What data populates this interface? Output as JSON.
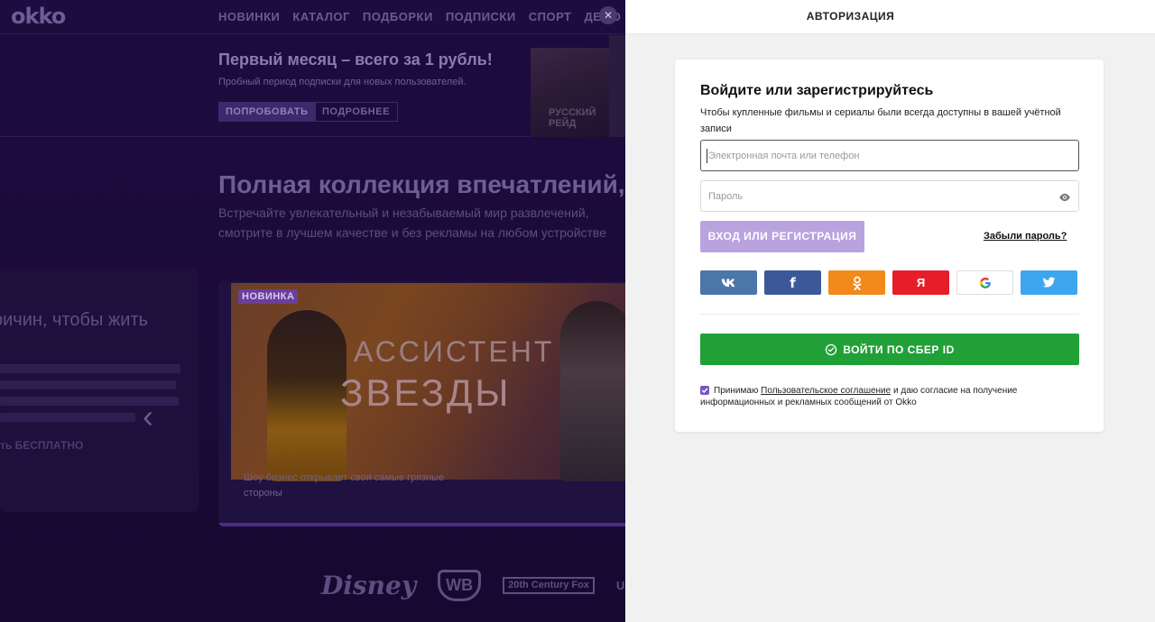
{
  "background": {
    "logo": "okko",
    "nav": [
      "НОВИНКИ",
      "КАТАЛОГ",
      "ПОДБОРКИ",
      "ПОДПИСКИ",
      "СПОРТ",
      "ДЕМО"
    ],
    "promo": {
      "title": "Первый месяц – всего за 1 рубль!",
      "subtitle": "Пробный период подписки для новых пользователей.",
      "try_label": "ПОПРОБОВАТЬ",
      "more_label": "ПОДРОБНЕЕ",
      "poster_text": "РУССКИЙ РЕЙД"
    },
    "hero": {
      "title": "Полная коллекция впечатлений, з",
      "subtitle": "Встречайте увлекательный и незабываемый мир развлечений, смотрите в лучшем качестве и без рекламы на любом устройстве"
    },
    "side_card": {
      "title": "ричин, чтобы жить",
      "link": "ть БЕСПЛАТНО"
    },
    "feature": {
      "badge": "НОВИНКА",
      "title_line1": "АССИСТЕНТ",
      "title_line2": "ЗВЕЗДЫ",
      "description": "Шоу бизнес открывает свои самые грязные стороны"
    },
    "studios": [
      "Disney",
      "WB",
      "20th Century Fox",
      "UNIVERSAL"
    ]
  },
  "auth": {
    "header_title": "АВТОРИЗАЦИЯ",
    "card_title": "Войдите или зарегистрируйтесь",
    "card_subtitle": "Чтобы купленные фильмы и сериалы были всегда доступны в вашей учётной записи",
    "email_placeholder": "Электронная почта или телефон",
    "password_placeholder": "Пароль",
    "login_button": "ВХОД ИЛИ РЕГИСТРАЦИЯ",
    "forgot_link": "Забыли пароль?",
    "socials": [
      {
        "name": "vk",
        "label": "vk",
        "color": "#4a76a8"
      },
      {
        "name": "facebook",
        "label": "f",
        "color": "#3b5998"
      },
      {
        "name": "odnoklassniki",
        "color": "#f2891b"
      },
      {
        "name": "yandex",
        "label": "Я",
        "color": "#e61e2a"
      },
      {
        "name": "google",
        "color": "#ffffff"
      },
      {
        "name": "twitter",
        "color": "#3ea6ee"
      }
    ],
    "sber_button": "ВОЙТИ ПО СБЕР ID",
    "consent": {
      "checked": true,
      "text_before": "Принимаю",
      "link": "Пользовательское соглашение",
      "text_after": "и даю согласие на получение",
      "line2": "информационных и рекламных сообщений от Okko"
    }
  },
  "colors": {
    "accent": "#7b54c2",
    "login_disabled": "#b9a3df",
    "sber_green": "#21a038"
  }
}
